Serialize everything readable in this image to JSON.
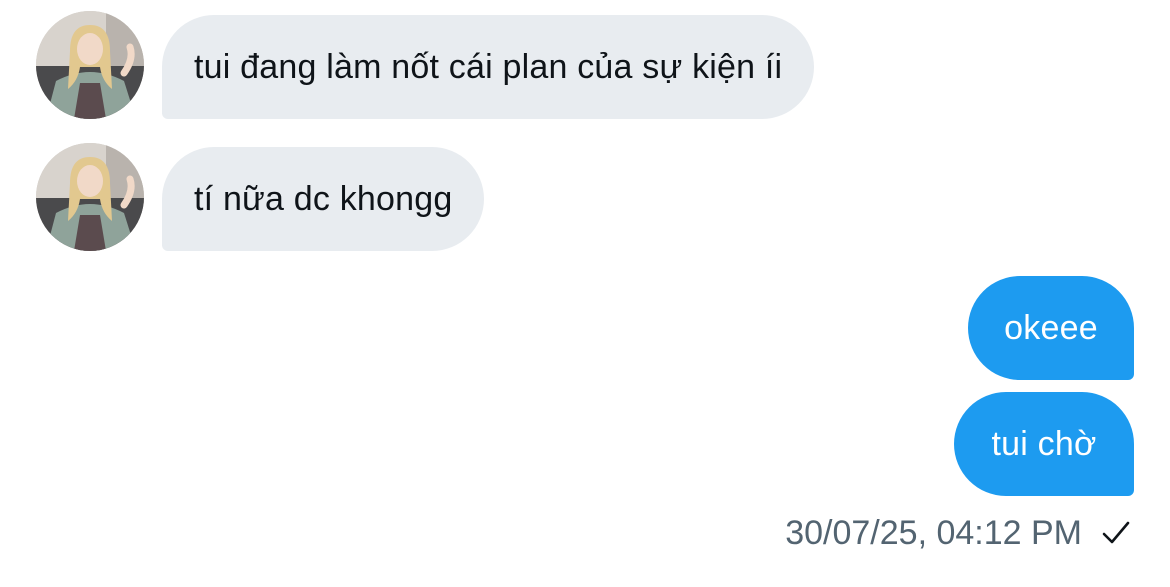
{
  "conversation": {
    "messages": [
      {
        "sender": "other",
        "text": "tui đang làm nốt cái plan của sự kiện íi"
      },
      {
        "sender": "other",
        "text": "tí nữa dc khongg"
      },
      {
        "sender": "me",
        "text": "okeee"
      },
      {
        "sender": "me",
        "text": "tui chờ"
      }
    ],
    "timestamp": "30/07/25, 04:12 PM",
    "status_icon": "checkmark-icon"
  },
  "colors": {
    "incoming_bubble": "#e8ecf0",
    "outgoing_bubble": "#1d9bf0",
    "incoming_text": "#0f1419",
    "outgoing_text": "#ffffff",
    "meta_text": "#536471"
  }
}
